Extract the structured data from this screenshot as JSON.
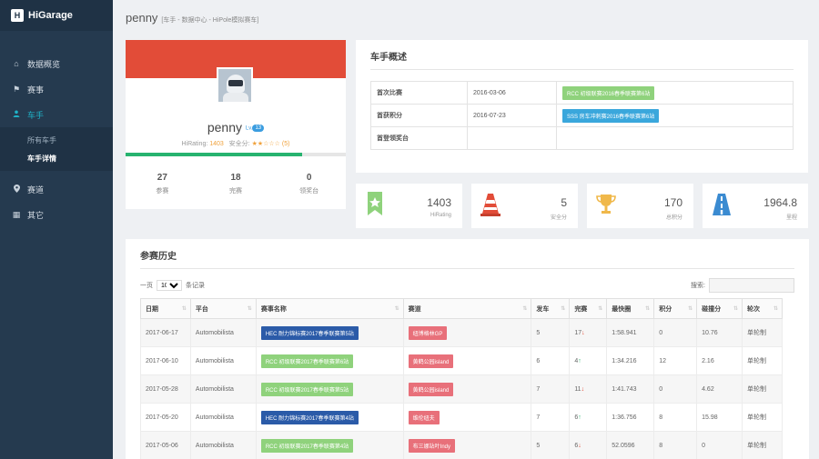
{
  "app": {
    "logo_mark": "H",
    "name": "HiGarage"
  },
  "sidebar": {
    "items": [
      {
        "icon": "home-icon",
        "glyph": "⌂",
        "label": "数据概览"
      },
      {
        "icon": "flag-icon",
        "glyph": "⚑",
        "label": "赛事"
      },
      {
        "icon": "user-icon",
        "glyph": "👤",
        "label": "车手"
      },
      {
        "icon": "pin-icon",
        "glyph": "●",
        "label": "赛道"
      },
      {
        "icon": "grid-icon",
        "glyph": "▦",
        "label": "其它"
      }
    ],
    "subitems": [
      {
        "label": "所有车手"
      },
      {
        "label": "车手详情"
      }
    ]
  },
  "header": {
    "title": "penny",
    "breadcrumb": "[车手 - 数据中心 - HiPole模拟赛车]"
  },
  "profile": {
    "name": "penny",
    "level_prefix": "Lv.",
    "level": "13",
    "rating_label": "HiRating:",
    "rating_value": "1403",
    "safety_label": "安全分:",
    "stars": "★★☆☆☆",
    "safety_value": "(5)",
    "progress": 0.8,
    "stats": [
      {
        "value": "27",
        "label": "参赛"
      },
      {
        "value": "18",
        "label": "完赛"
      },
      {
        "value": "0",
        "label": "领奖台"
      }
    ]
  },
  "overview": {
    "title": "车手概述",
    "rows": [
      {
        "key": "首次比赛",
        "date": "2016-03-06",
        "event": "RCC 初级联赛2016春季联赛第6站",
        "color": "#8fd27c"
      },
      {
        "key": "首获积分",
        "date": "2016-07-23",
        "event": "SSS 房车冲刺赛2016春季联赛第6站",
        "color": "#3aa7dc"
      },
      {
        "key": "首登领奖台",
        "date": "",
        "event": "",
        "color": ""
      }
    ]
  },
  "stat_cards": [
    {
      "icon": "ribbon-icon",
      "value": "1403",
      "label": "HiRating",
      "color": "#8fd27c"
    },
    {
      "icon": "cone-icon",
      "value": "5",
      "label": "安全分",
      "color": "#e24c38"
    },
    {
      "icon": "trophy-icon",
      "value": "170",
      "label": "总积分",
      "color": "#f0b84a"
    },
    {
      "icon": "road-icon",
      "value": "1964.8",
      "label": "里程",
      "color": "#3b8bd1"
    }
  ],
  "history": {
    "title": "参赛历史",
    "per_page_prefix": "一页",
    "per_page_value": "10",
    "per_page_suffix": "条记录",
    "search_label": "搜索:",
    "columns": [
      "日期",
      "平台",
      "赛事名称",
      "赛道",
      "发车",
      "完赛",
      "最快圈",
      "积分",
      "碰撞分",
      "轮次"
    ],
    "rows": [
      {
        "date": "2017-06-17",
        "platform": "Automobilista",
        "event": "HEC 耐力锦标赛2017春季联赛第5站",
        "event_color": "#2b5ba8",
        "track": "纽博格林GP",
        "track_color": "#e8707a",
        "start": "5",
        "finish": "17",
        "trend": "down",
        "lap": "1:58.941",
        "points": "0",
        "collision": "10.76",
        "round": "单轮制"
      },
      {
        "date": "2017-06-10",
        "platform": "Automobilista",
        "event": "RCC 初级联赛2017春季联赛第6站",
        "event_color": "#8fd27c",
        "track": "黄鹤公园island",
        "track_color": "#e8707a",
        "start": "6",
        "finish": "4",
        "trend": "up",
        "lap": "1:34.216",
        "points": "12",
        "collision": "2.16",
        "round": "单轮制"
      },
      {
        "date": "2017-05-28",
        "platform": "Automobilista",
        "event": "RCC 初级联赛2017春季联赛第5站",
        "event_color": "#8fd27c",
        "track": "黄鹤公园island",
        "track_color": "#e8707a",
        "start": "7",
        "finish": "11",
        "trend": "down",
        "lap": "1:41.743",
        "points": "0",
        "collision": "4.62",
        "round": "单轮制"
      },
      {
        "date": "2017-05-20",
        "platform": "Automobilista",
        "event": "HEC 耐力锦标赛2017春季联赛第4站",
        "event_color": "#2b5ba8",
        "track": "维伦纽夫",
        "track_color": "#e8707a",
        "start": "7",
        "finish": "6",
        "trend": "up",
        "lap": "1:36.756",
        "points": "8",
        "collision": "15.98",
        "round": "单轮制"
      },
      {
        "date": "2017-05-06",
        "platform": "Automobilista",
        "event": "RCC 初级联赛2017春季联赛第4站",
        "event_color": "#8fd27c",
        "track": "布三娜站叶Indy",
        "track_color": "#e8707a",
        "start": "5",
        "finish": "6",
        "trend": "down",
        "lap": "52.0596",
        "points": "8",
        "collision": "0",
        "round": "单轮制"
      }
    ]
  }
}
